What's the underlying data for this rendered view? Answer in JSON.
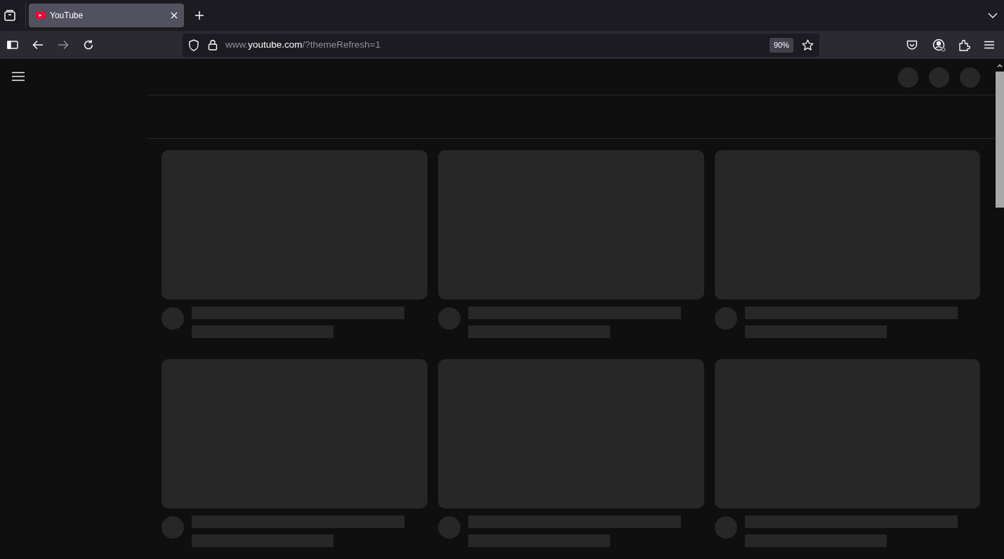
{
  "browser": {
    "tab": {
      "title": "YouTube",
      "selected": true
    },
    "url": {
      "prefix": "www.",
      "domain": "youtube.com",
      "path": "/?themeRefresh=1"
    },
    "zoom": "90%"
  },
  "feed": {
    "cards": [
      {
        "kind": "skeleton"
      },
      {
        "kind": "skeleton"
      },
      {
        "kind": "skeleton"
      },
      {
        "kind": "skeleton"
      },
      {
        "kind": "skeleton"
      },
      {
        "kind": "skeleton"
      }
    ]
  }
}
